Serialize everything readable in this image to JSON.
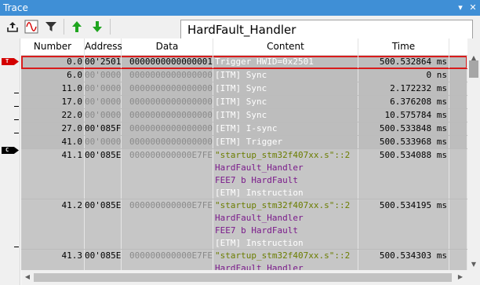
{
  "window": {
    "title": "Trace",
    "pin_glyph": "▾",
    "close_glyph": "✕"
  },
  "toolbar": {
    "buttons": [
      {
        "name": "export-icon"
      },
      {
        "name": "waveform-icon"
      },
      {
        "name": "filter-icon"
      },
      {
        "name": "arrow-up-icon"
      },
      {
        "name": "arrow-down-icon"
      }
    ],
    "function_box": "HardFault_Handler"
  },
  "columns": [
    "Number",
    "Address",
    "Data",
    "Content",
    "Time"
  ],
  "badges": {
    "trigger": "T",
    "cursor": "C"
  },
  "rows": [
    {
      "number": "0.0",
      "address": "00'2501",
      "data": "0000000000000001",
      "content": [
        "Trigger HWID=0x2501"
      ],
      "time": "500.532864 ms"
    },
    {
      "number": "6.0",
      "address": "00'0000",
      "data": "0000000000000000",
      "content": [
        "[ITM] Sync"
      ],
      "time": "0 ns"
    },
    {
      "number": "11.0",
      "address": "00'0000",
      "data": "0000000000000000",
      "content": [
        "[ITM] Sync"
      ],
      "time": "2.172232 ms"
    },
    {
      "number": "17.0",
      "address": "00'0000",
      "data": "0000000000000000",
      "content": [
        "[ITM] Sync"
      ],
      "time": "6.376208 ms"
    },
    {
      "number": "22.0",
      "address": "00'0000",
      "data": "0000000000000000",
      "content": [
        "[ITM] Sync"
      ],
      "time": "10.575784 ms"
    },
    {
      "number": "27.0",
      "address": "00'085F",
      "data": "0000000000000000",
      "content": [
        "[ETM] I-sync"
      ],
      "time": "500.533848 ms"
    },
    {
      "number": "41.0",
      "address": "00'0000",
      "data": "0000000000000000",
      "content": [
        "[ETM] Trigger"
      ],
      "time": "500.533968 ms"
    },
    {
      "number": "41.1",
      "address": "00'085E",
      "data": "000000000000E7FE",
      "content": [
        "\"startup_stm32f407xx.s\"::2",
        "HardFault_Handler",
        "FEE7 b          HardFault",
        "[ETM] Instruction"
      ],
      "time": "500.534088 ms"
    },
    {
      "number": "41.2",
      "address": "00'085E",
      "data": "000000000000E7FE",
      "content": [
        "\"startup_stm32f407xx.s\"::2",
        "HardFault_Handler",
        "FEE7 b          HardFault",
        "[ETM] Instruction"
      ],
      "time": "500.534195 ms"
    },
    {
      "number": "41.3",
      "address": "00'085E",
      "data": "000000000000E7FE",
      "content": [
        "\"startup_stm32f407xx.s\"::2",
        "HardFault_Handler"
      ],
      "time": "500.534303 ms"
    }
  ],
  "colors": {
    "titlebar": "#3f8fd6",
    "selection": "#d81b1b",
    "source_line": "#6b7d00",
    "symbol": "#7a1a8a"
  }
}
